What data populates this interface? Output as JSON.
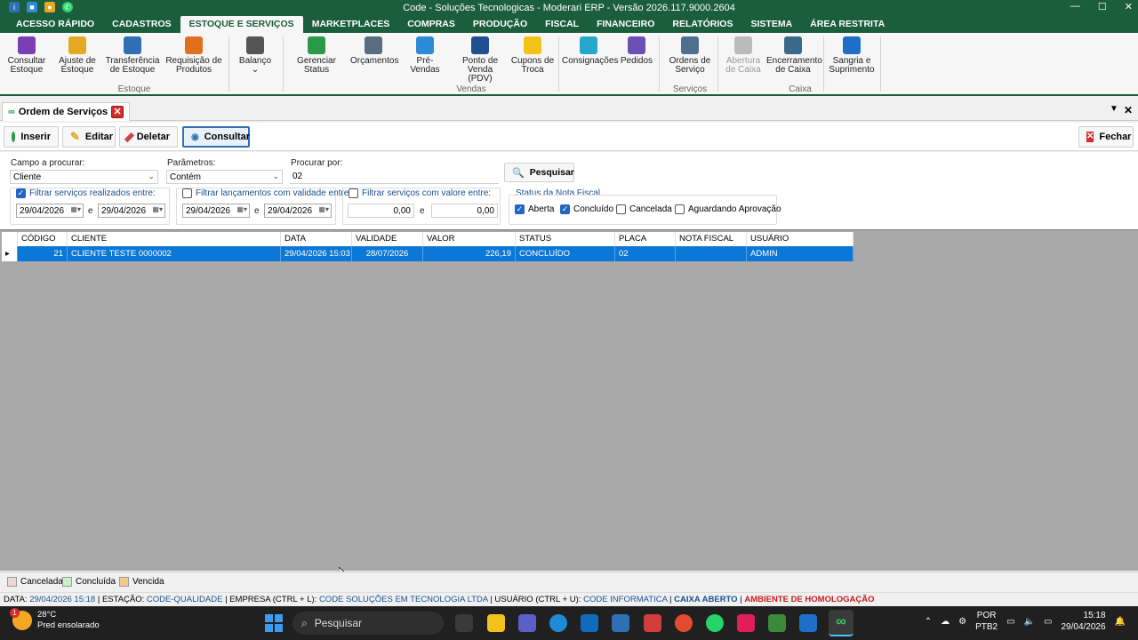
{
  "window": {
    "title": "Code - Soluções Tecnologicas - Moderari ERP - Versão 2026.117.9000.2604",
    "minimize": "—",
    "maximize": "☐",
    "close": "✕"
  },
  "menu": [
    "ACESSO RÁPIDO",
    "CADASTROS",
    "ESTOQUE E SERVIÇOS",
    "MARKETPLACES",
    "COMPRAS",
    "PRODUÇÃO",
    "FISCAL",
    "FINANCEIRO",
    "RELATÓRIOS",
    "SISTEMA",
    "ÁREA RESTRITA"
  ],
  "ribbon": {
    "buttons": [
      {
        "l1": "Consultar",
        "l2": "Estoque",
        "icon": "barcode-icon",
        "color": "#7b3fb5"
      },
      {
        "l1": "Ajuste de",
        "l2": "Estoque",
        "icon": "worker-cart-icon",
        "color": "#e5a823"
      },
      {
        "l1": "Transferência",
        "l2": "de Estoque",
        "icon": "transfer-icon",
        "color": "#2f6fb3"
      },
      {
        "l1": "Requisição de",
        "l2": "Produtos",
        "icon": "person-box-icon",
        "color": "#e0701e"
      },
      {
        "l1": "Balanço",
        "l2": "⌄",
        "icon": "scanner-icon",
        "color": "#555555"
      },
      {
        "l1": "Gerenciar",
        "l2": "Status",
        "icon": "check-board-icon",
        "color": "#2a9a4a"
      },
      {
        "l1": "Orçamentos",
        "l2": "",
        "icon": "calculator-icon",
        "color": "#5a6d7e"
      },
      {
        "l1": "Pré-Vendas",
        "l2": "",
        "icon": "cart-icon",
        "color": "#2f8ad6"
      },
      {
        "l1": "Ponto de",
        "l2": "Venda (PDV)",
        "icon": "pos-icon",
        "color": "#1f4f8f"
      },
      {
        "l1": "Cupons de",
        "l2": "Troca",
        "icon": "coupon-icon",
        "color": "#f2c21b"
      },
      {
        "l1": "Consignações",
        "l2": "",
        "icon": "consign-icon",
        "color": "#24a7c9"
      },
      {
        "l1": "Pedidos",
        "l2": "",
        "icon": "orders-icon",
        "color": "#6b4fb5"
      },
      {
        "l1": "Ordens de",
        "l2": "Serviço",
        "icon": "gears-icon",
        "color": "#4f6f8f"
      },
      {
        "l1": "Abertura",
        "l2": "de Caixa",
        "icon": "cash-open-icon",
        "color": "#bbbbbb"
      },
      {
        "l1": "Encerramento",
        "l2": "de Caixa",
        "icon": "cash-register-icon",
        "color": "#3a6a8a"
      },
      {
        "l1": "Sangria e",
        "l2": "Suprimento",
        "icon": "money-icon",
        "color": "#1f6fc9"
      }
    ],
    "groups": [
      "Estoque",
      "Vendas",
      "Serviços",
      "Caixa"
    ]
  },
  "doc_tab": {
    "label": "Ordem de Serviços",
    "close": "✕",
    "pin": "▼",
    "close_all": "✕"
  },
  "toolbar": {
    "insert": "Inserir",
    "edit": "Editar",
    "delete": "Deletar",
    "query": "Consultar",
    "close": "Fechar"
  },
  "filters": {
    "field_label": "Campo a procurar:",
    "field_value": "Cliente",
    "params_label": "Parâmetros:",
    "params_value": "Contém",
    "search_label": "Procurar por:",
    "search_value": "02",
    "search_button": "Pesquisar",
    "f1_label": "Filtrar serviços realizados entre:",
    "f1_checked": true,
    "f1_from": "29/04/2026",
    "f1_to": "29/04/2026",
    "f2_label": "Filtrar lançamentos com validade entre:",
    "f2_checked": false,
    "f2_from": "29/04/2026",
    "f2_to": "29/04/2026",
    "f3_label": "Filtrar serviços com valore entre:",
    "f3_checked": false,
    "f3_from": "0,00",
    "f3_to": "0,00",
    "and_word": "e",
    "status_label": "Status da Nota Fiscal",
    "status_options": [
      {
        "label": "Aberta",
        "checked": true
      },
      {
        "label": "Concluído",
        "checked": true
      },
      {
        "label": "Cancelada",
        "checked": false
      },
      {
        "label": "Aguardando Aprovação",
        "checked": false
      }
    ]
  },
  "grid": {
    "columns": [
      "CÓDIGO",
      "CLIENTE",
      "DATA",
      "VALIDADE",
      "VALOR",
      "STATUS",
      "PLACA",
      "NOTA FISCAL",
      "USUÁRIO"
    ],
    "rows": [
      [
        "21",
        "CLIENTE TESTE 0000002",
        "29/04/2026 15:03",
        "28/07/2026",
        "226,19",
        "CONCLUÍDO",
        "02",
        "",
        "ADMIN"
      ]
    ],
    "row_marker": "▸"
  },
  "legend": [
    {
      "label": "Cancelada",
      "color": "#e8d9d5"
    },
    {
      "label": "Concluída",
      "color": "#c9f0c9"
    },
    {
      "label": "Vencida",
      "color": "#f3c98a"
    }
  ],
  "statusbar": {
    "data_label": "DATA:",
    "data_value": "29/04/2026 15:18",
    "estacao_label": "ESTAÇÃO:",
    "estacao_value": "CODE-QUALIDADE",
    "empresa_label": "EMPRESA (CTRL + L):",
    "empresa_value": "CODE SOLUÇÕES EM TECNOLOGIA LTDA",
    "usuario_label": "USUÁRIO (CTRL + U):",
    "usuario_value": "CODE INFORMATICA",
    "caixa": "CAIXA ABERTO",
    "ambiente": "AMBIENTE DE HOMOLOGAÇÃO",
    "sep": "|"
  },
  "taskbar": {
    "temp": "28°C",
    "weather": "Pred ensolarado",
    "search": "Pesquisar",
    "lang1": "POR",
    "lang2": "PTB2",
    "time": "15:18",
    "date": "29/04/2026",
    "badge": "1"
  }
}
